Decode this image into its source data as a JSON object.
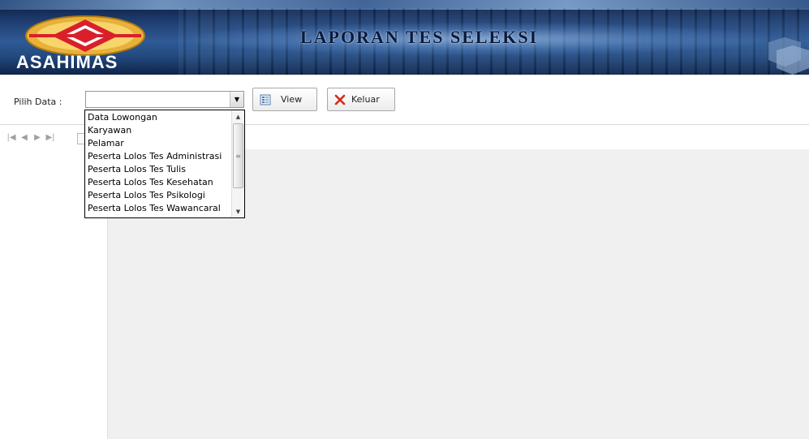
{
  "banner": {
    "logo_text": "ASAHIMAS",
    "title": "LAPORAN TES SELEKSI"
  },
  "toolbar": {
    "pilih_label": "Pilih Data :",
    "combo_value": "",
    "view_label": "View",
    "keluar_label": "Keluar"
  },
  "dropdown": {
    "items": [
      "Data Lowongan",
      "Karyawan",
      "Pelamar",
      "Peserta Lolos Tes Administrasi",
      "Peserta Lolos Tes Tulis",
      "Peserta Lolos Tes Kesehatan",
      "Peserta Lolos Tes Psikologi",
      "Peserta Lolos Tes Wawancaral"
    ]
  },
  "icons": {
    "view": "view-icon",
    "keluar": "close-icon",
    "nav_first": "first-page-icon",
    "nav_prev": "prev-page-icon",
    "nav_next": "next-page-icon",
    "nav_last": "last-page-icon",
    "export": "export-icon"
  },
  "colors": {
    "banner_dark": "#0b1a3a",
    "banner_mid": "#2f5a95",
    "logo_red": "#d9202a",
    "logo_gold": "#e8b13a",
    "keluar_red": "#d42a1a"
  }
}
